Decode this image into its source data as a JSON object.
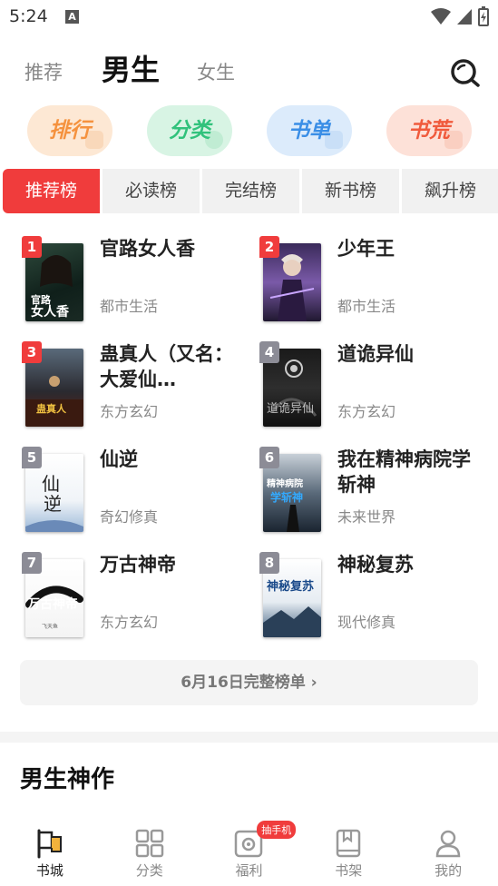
{
  "status_bar": {
    "time": "5:24",
    "notif_letter": "A"
  },
  "top_tabs": {
    "recommend": "推荐",
    "male": "男生",
    "female": "女生"
  },
  "categories": [
    {
      "label": "排行",
      "color": "#f5923e",
      "bg": "#fde8d4"
    },
    {
      "label": "分类",
      "color": "#31c27c",
      "bg": "#d8f4e4"
    },
    {
      "label": "书单",
      "color": "#3a8ee6",
      "bg": "#dcebfb"
    },
    {
      "label": "书荒",
      "color": "#f05a3c",
      "bg": "#fde1d8"
    }
  ],
  "rank_tabs": [
    "推荐榜",
    "必读榜",
    "完结榜",
    "新书榜",
    "飙升榜"
  ],
  "books": [
    {
      "rank": "1",
      "title": "官路女人香",
      "genre": "都市生活",
      "cover_text": "官路女人香"
    },
    {
      "rank": "2",
      "title": "少年王",
      "genre": "都市生活",
      "cover_text": ""
    },
    {
      "rank": "3",
      "title": "蛊真人（又名：大爱仙…",
      "genre": "东方玄幻",
      "cover_text": "蛊真人"
    },
    {
      "rank": "4",
      "title": "道诡异仙",
      "genre": "东方玄幻",
      "cover_text": "道诡异仙"
    },
    {
      "rank": "5",
      "title": "仙逆",
      "genre": "奇幻修真",
      "cover_text": "仙逆"
    },
    {
      "rank": "6",
      "title": "我在精神病院学斩神",
      "genre": "未来世界",
      "cover_text": "精神病院学斩神"
    },
    {
      "rank": "7",
      "title": "万古神帝",
      "genre": "东方玄幻",
      "cover_text": "万古神帝"
    },
    {
      "rank": "8",
      "title": "神秘复苏",
      "genre": "现代修真",
      "cover_text": "神秘复苏"
    }
  ],
  "full_list_label": "6月16日完整榜单 ›",
  "section_title": "男生神作",
  "bottom_nav": {
    "bookstore": "书城",
    "category": "分类",
    "welfare": "福利",
    "welfare_badge": "抽手机",
    "bookshelf": "书架",
    "mine": "我的"
  },
  "colors": {
    "accent": "#f03c3c",
    "rank_top3": "#f03c3c",
    "rank_other": "#8c8c96"
  }
}
